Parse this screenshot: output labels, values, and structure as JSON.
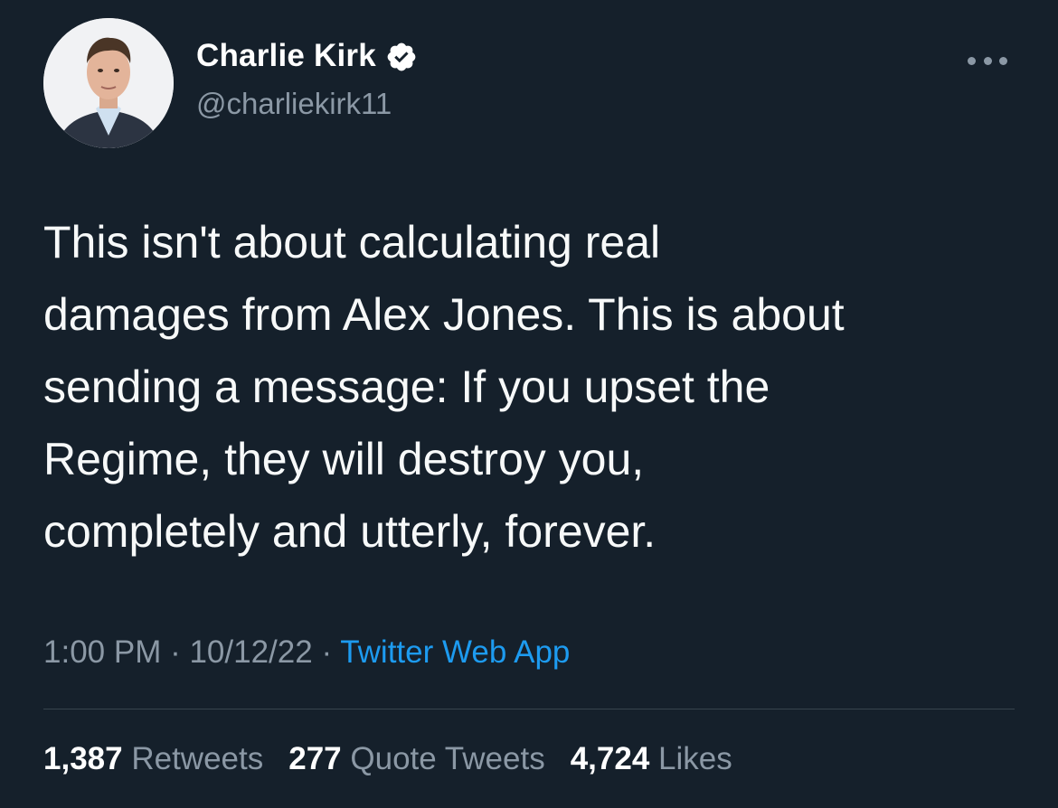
{
  "author": {
    "display_name": "Charlie Kirk",
    "handle": "@charliekirk11",
    "verified_icon": "verified-badge-icon",
    "avatar_icon": "profile-photo"
  },
  "more_icon": "more-options-icon",
  "tweet": {
    "text": "This isn't about calculating real\ndamages from Alex Jones. This is about\nsending a message: If you upset the\nRegime, they will destroy you,\ncompletely and utterly, forever."
  },
  "meta": {
    "time": "1:00 PM",
    "sep1": " · ",
    "date": "10/12/22",
    "sep2": " · ",
    "source": "Twitter Web App"
  },
  "stats": {
    "retweets_count": "1,387",
    "retweets_label": "Retweets",
    "quotes_count": "277",
    "quotes_label": "Quote Tweets",
    "likes_count": "4,724",
    "likes_label": "Likes"
  },
  "colors": {
    "background": "#15202b",
    "text": "#f7f9f9",
    "secondary": "#8b98a5",
    "link": "#1d9bf0",
    "divider": "#38444d"
  }
}
